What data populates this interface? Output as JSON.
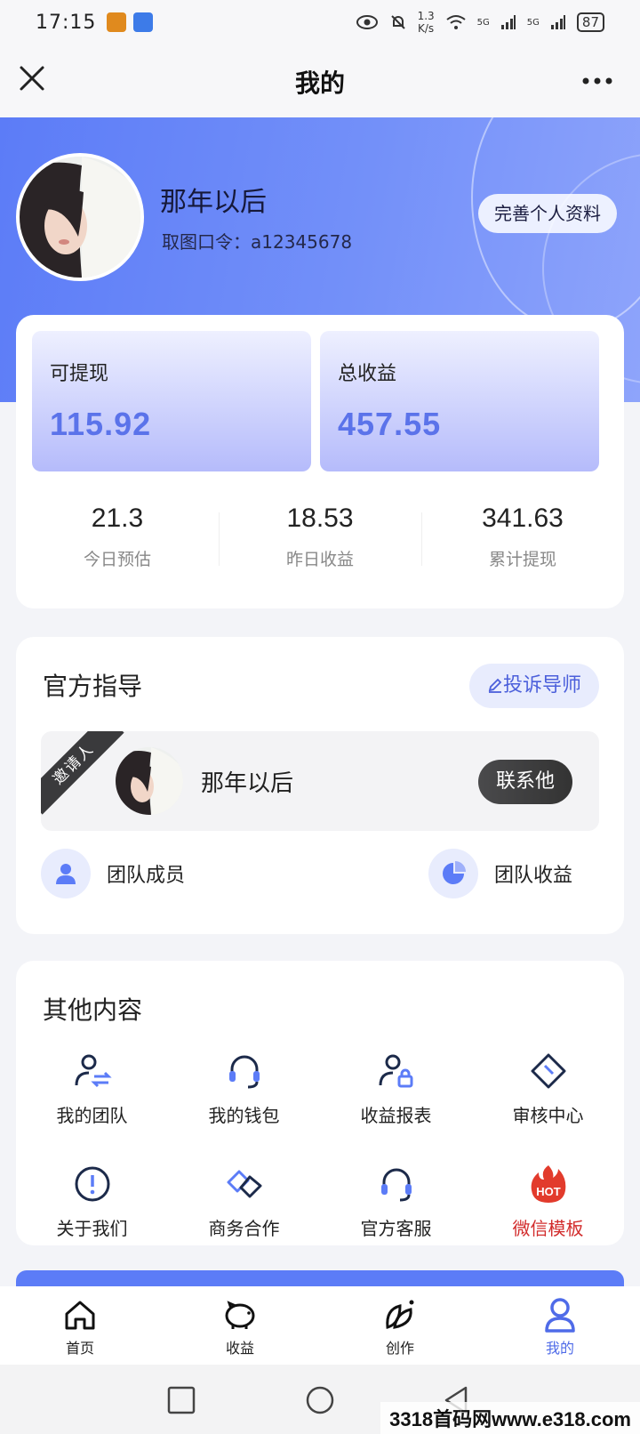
{
  "status_bar": {
    "time": "17:15",
    "speed_value": "1.3",
    "speed_unit": "K/s",
    "net1": "5G",
    "net2": "5G",
    "battery": "87"
  },
  "nav": {
    "title": "我的",
    "close_icon": "close-icon",
    "more_icon": "more-icon"
  },
  "profile": {
    "name": "那年以后",
    "code_label": "取图口令：a12345678",
    "edit_button": "完善个人资料"
  },
  "earnings": {
    "withdrawable_label": "可提现",
    "withdrawable_value": "115.92",
    "total_label": "总收益",
    "total_value": "457.55",
    "stats": [
      {
        "value": "21.3",
        "label": "今日预估"
      },
      {
        "value": "18.53",
        "label": "昨日收益"
      },
      {
        "value": "341.63",
        "label": "累计提现"
      }
    ]
  },
  "guide": {
    "title": "官方指导",
    "complain_button": "投诉导师",
    "ribbon": "邀请人",
    "inviter_name": "那年以后",
    "contact_button": "联系他",
    "team_members": "团队成员",
    "team_income": "团队收益"
  },
  "other": {
    "title": "其他内容",
    "items": [
      {
        "label": "我的团队",
        "icon": "team-swap-icon"
      },
      {
        "label": "我的钱包",
        "icon": "headset-icon"
      },
      {
        "label": "收益报表",
        "icon": "user-lock-icon"
      },
      {
        "label": "审核中心",
        "icon": "tag-icon"
      },
      {
        "label": "关于我们",
        "icon": "info-icon"
      },
      {
        "label": "商务合作",
        "icon": "handshake-icon"
      },
      {
        "label": "官方客服",
        "icon": "headset-icon"
      },
      {
        "label": "微信模板",
        "icon": "hot-fire-icon"
      }
    ]
  },
  "tabbar": {
    "items": [
      {
        "label": "首页",
        "icon": "home-icon"
      },
      {
        "label": "收益",
        "icon": "piggy-bank-icon"
      },
      {
        "label": "创作",
        "icon": "leaf-icon"
      },
      {
        "label": "我的",
        "icon": "user-icon"
      }
    ],
    "active_color": "#4f6be8"
  },
  "colors": {
    "accent": "#5c7cf7",
    "value_blue": "#5b73ea",
    "hot_red": "#d22c2c"
  },
  "watermark": "3318首码网www.e318.com"
}
